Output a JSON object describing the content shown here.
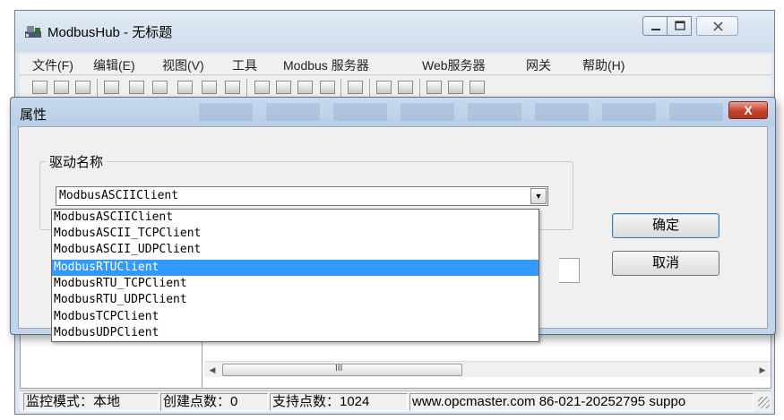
{
  "app": {
    "title": "ModbusHub - 无标题",
    "window_buttons": {
      "minimize": "—",
      "maximize": "☐",
      "close": "✕"
    }
  },
  "menu": [
    "文件(F)",
    "编辑(E)",
    "视图(V)",
    "工具",
    "Modbus 服务器",
    "Web服务器",
    "网关",
    "帮助(H)"
  ],
  "toolbar_icons": [
    "new-icon",
    "open-icon",
    "save-icon",
    "add-device-icon",
    "add-group-icon",
    "table-icon",
    "tool-icon",
    "tag-icon",
    "properties-icon",
    "cut-icon",
    "copy-icon",
    "paste-icon",
    "delete-icon",
    "chart-icon",
    "run-icon",
    "stop-icon",
    "config-icon",
    "load-icon",
    "export-icon"
  ],
  "dialog": {
    "title": "属性",
    "close": "X",
    "group_label": "驱动名称",
    "combo_value": "ModbusASCIIClient",
    "combo_arrow": "▼",
    "ok": "确定",
    "cancel": "取消"
  },
  "dropdown": {
    "options": [
      "ModbusASCIIClient",
      "ModbusASCII_TCPClient",
      "ModbusASCII_UDPClient",
      "ModbusRTUClient",
      "ModbusRTU_TCPClient",
      "ModbusRTU_UDPClient",
      "ModbusTCPClient",
      "ModbusUDPClient"
    ],
    "selected_index": 3
  },
  "scrollbar": {
    "left_arrow": "◀",
    "grip": "III",
    "right_arrow": "▶"
  },
  "status": {
    "mode": "监控模式：本地",
    "created": "创建点数：0",
    "supported": "支持点数：1024",
    "info": "www.opcmaster.com 86-021-20252795 suppo"
  },
  "colors": {
    "selection": "#3399ff",
    "dialog_close": "#c5422f",
    "titlebar": "#cfdcec"
  }
}
